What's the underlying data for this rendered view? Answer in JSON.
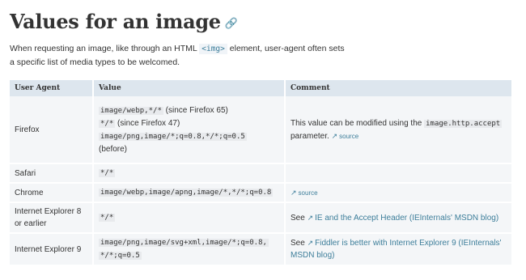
{
  "heading": {
    "title": "Values for an image",
    "anchor_icon": "link-icon"
  },
  "intro": {
    "text_before": "When requesting an image, like through an HTML ",
    "code": "<img>",
    "text_after": " element, user-agent often sets a specific list of media types to be welcomed."
  },
  "table": {
    "headers": [
      "User Agent",
      "Value",
      "Comment"
    ],
    "rows": [
      {
        "agent": "Firefox",
        "value_lines": [
          {
            "code": "image/webp,*/*",
            "note": " (since Firefox 65)"
          },
          {
            "code": "*/*",
            "note": " (since Firefox 47)"
          },
          {
            "code": "image/png,image/*;q=0.8,*/*;q=0.5",
            "note": ""
          },
          {
            "code": "",
            "note": "(before)"
          }
        ],
        "comment_before": "This value can be modified using the ",
        "comment_code": "image.http.accept",
        "comment_after": " parameter. ",
        "comment_link": "source"
      },
      {
        "agent": "Safari",
        "value": "*/*"
      },
      {
        "agent": "Chrome",
        "value": "image/webp,image/apng,image/*,*/*;q=0.8",
        "comment_link": "source"
      },
      {
        "agent": "Internet Explorer 8 or earlier",
        "value": "*/*",
        "comment_prefix": "See ",
        "comment_link": "IE and the Accept Header (IEInternals' MSDN blog)"
      },
      {
        "agent": "Internet Explorer 9",
        "value_lines": [
          "image/png,image/svg+xml,image/*;q=0.8,",
          "*/*;q=0.5"
        ],
        "comment_prefix": "See ",
        "comment_link": "Fiddler is better with Internet Explorer 9 (IEInternals' MSDN blog)"
      }
    ]
  },
  "icons": {
    "external_link": "external-link-icon"
  }
}
